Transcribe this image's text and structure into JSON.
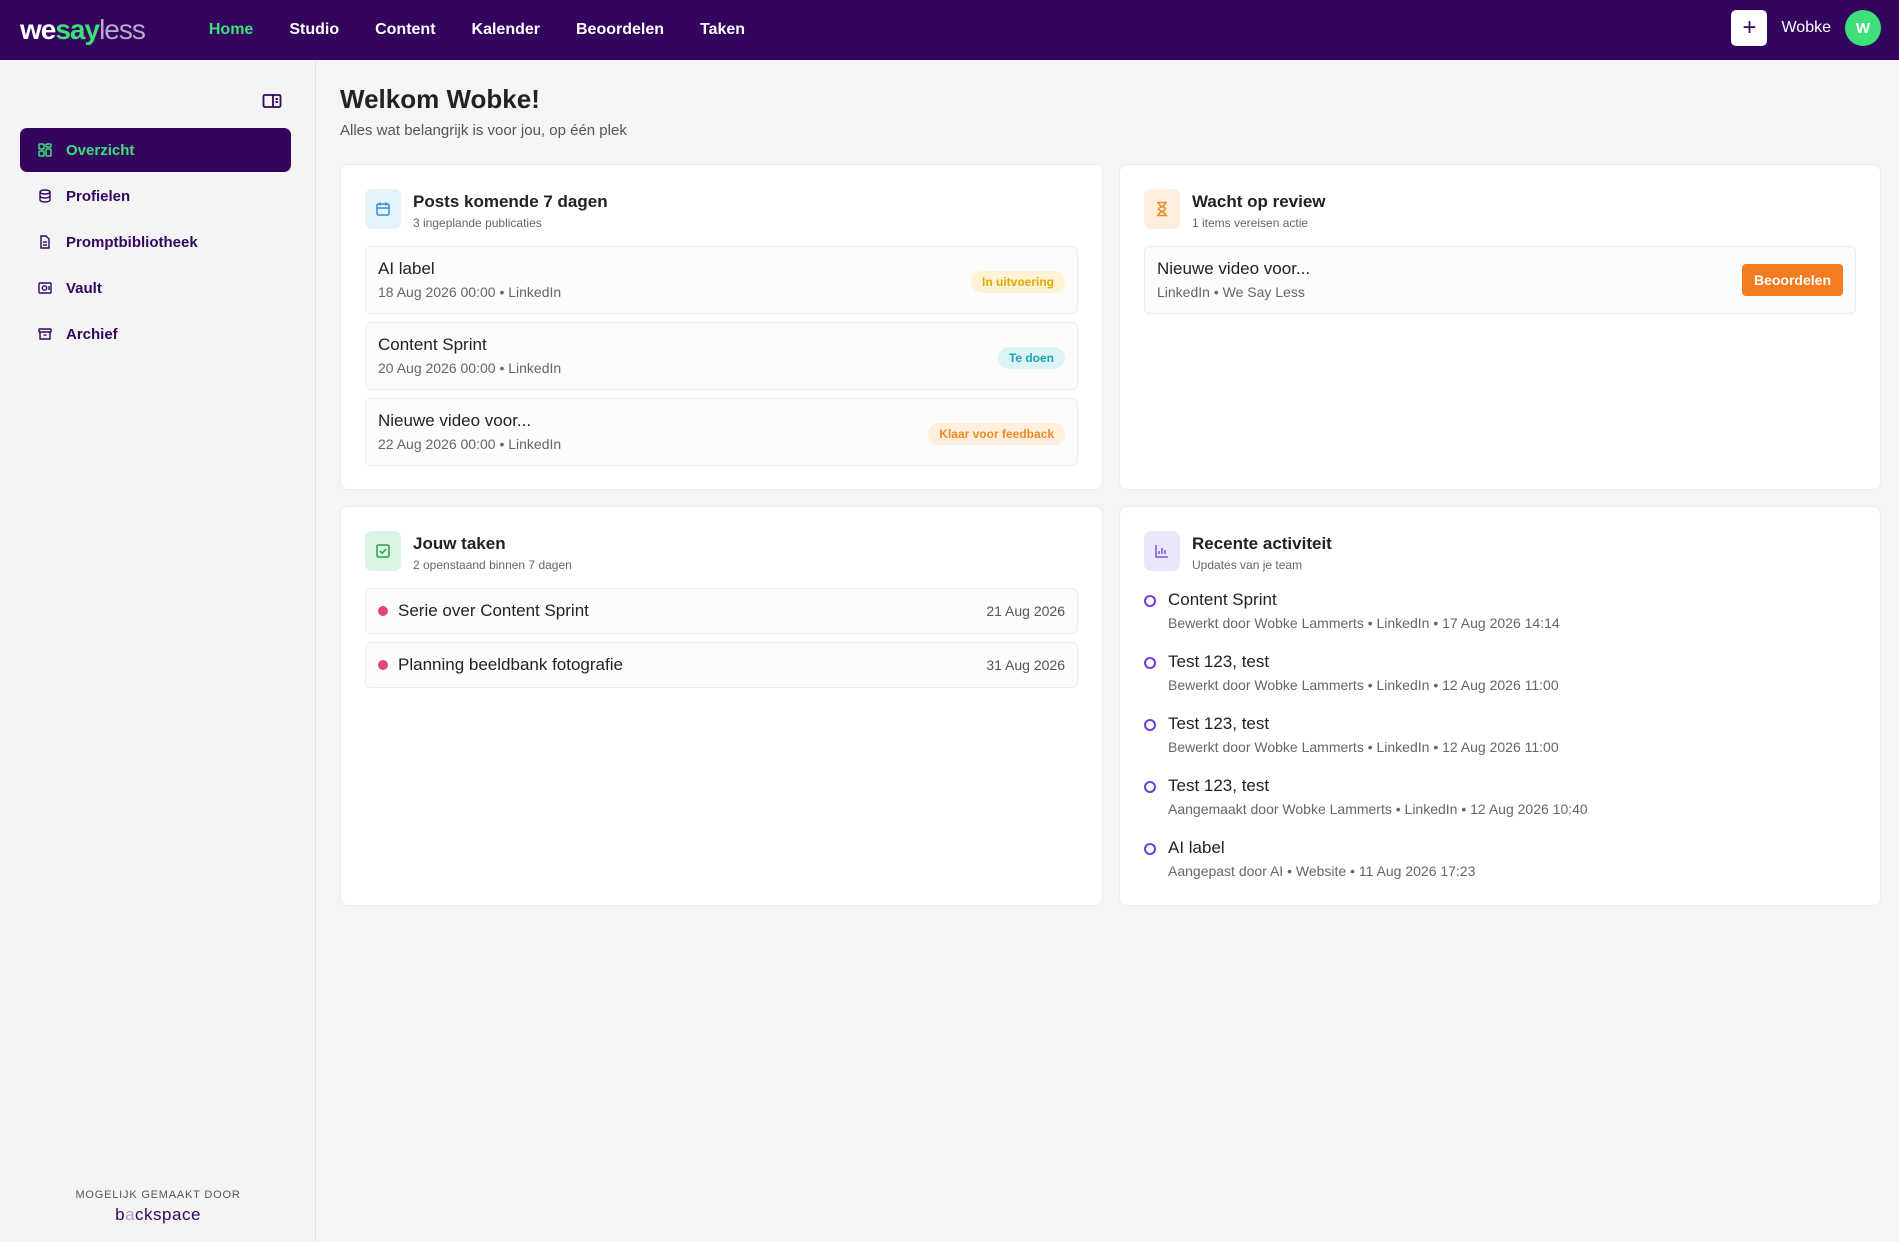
{
  "brand": {
    "we": "we",
    "say": "say",
    "less": "less"
  },
  "nav": [
    {
      "label": "Home",
      "active": true
    },
    {
      "label": "Studio"
    },
    {
      "label": "Content"
    },
    {
      "label": "Kalender"
    },
    {
      "label": "Beoordelen"
    },
    {
      "label": "Taken"
    }
  ],
  "user": {
    "name": "Wobke",
    "initial": "W",
    "plus": "+"
  },
  "sidebar": {
    "items": [
      {
        "label": "Overzicht",
        "icon": "dashboard-icon",
        "active": true
      },
      {
        "label": "Profielen",
        "icon": "database-icon"
      },
      {
        "label": "Promptbibliotheek",
        "icon": "document-icon"
      },
      {
        "label": "Vault",
        "icon": "safe-icon"
      },
      {
        "label": "Archief",
        "icon": "archive-icon"
      }
    ],
    "footer": {
      "made_by": "MOGELIJK GEMAAKT DOOR",
      "brand_b": "b",
      "brand_a": "a",
      "brand_rest": "ckspace"
    }
  },
  "page": {
    "title": "Welkom Wobke!",
    "subtitle": "Alles wat belangrijk is voor jou, op één plek"
  },
  "posts": {
    "title": "Posts komende 7 dagen",
    "subtitle": "3 ingeplande publicaties",
    "items": [
      {
        "title": "AI label",
        "meta": "18 Aug 2026 00:00 • LinkedIn",
        "status": "In uitvoering",
        "status_bg": "#fdf3d4",
        "status_fg": "#e0a800"
      },
      {
        "title": "Content Sprint",
        "meta": "20 Aug 2026 00:00 • LinkedIn",
        "status": "Te doen",
        "status_bg": "#ddf4f7",
        "status_fg": "#1aa3b8"
      },
      {
        "title": "Nieuwe video voor...",
        "meta": "22 Aug 2026 00:00 • LinkedIn",
        "status": "Klaar voor feedback",
        "status_bg": "#fdeedd",
        "status_fg": "#f08a24"
      }
    ]
  },
  "review": {
    "title": "Wacht op review",
    "subtitle": "1 items vereisen actie",
    "items": [
      {
        "title": "Nieuwe video voor...",
        "meta": "LinkedIn • We Say Less",
        "action": "Beoordelen"
      }
    ]
  },
  "tasks": {
    "title": "Jouw taken",
    "subtitle": "2 openstaand binnen 7 dagen",
    "items": [
      {
        "title": "Serie over Content Sprint",
        "date": "21 Aug 2026"
      },
      {
        "title": "Planning beeldbank fotografie",
        "date": "31 Aug 2026"
      }
    ]
  },
  "activity": {
    "title": "Recente activiteit",
    "subtitle": "Updates van je team",
    "items": [
      {
        "title": "Content Sprint",
        "meta": "Bewerkt door Wobke Lammerts • LinkedIn • 17 Aug 2026 14:14"
      },
      {
        "title": "Test 123, test",
        "meta": "Bewerkt door Wobke Lammerts • LinkedIn • 12 Aug 2026 11:00"
      },
      {
        "title": "Test 123, test",
        "meta": "Bewerkt door Wobke Lammerts • LinkedIn • 12 Aug 2026 11:00"
      },
      {
        "title": "Test 123, test",
        "meta": "Aangemaakt door Wobke Lammerts • LinkedIn • 12 Aug 2026 10:40"
      },
      {
        "title": "AI label",
        "meta": "Aangepast door AI • Website • 11 Aug 2026 17:23"
      }
    ]
  },
  "colors": {
    "brand": "#33055f",
    "accent": "#3ee07a",
    "action": "#f47b20"
  }
}
